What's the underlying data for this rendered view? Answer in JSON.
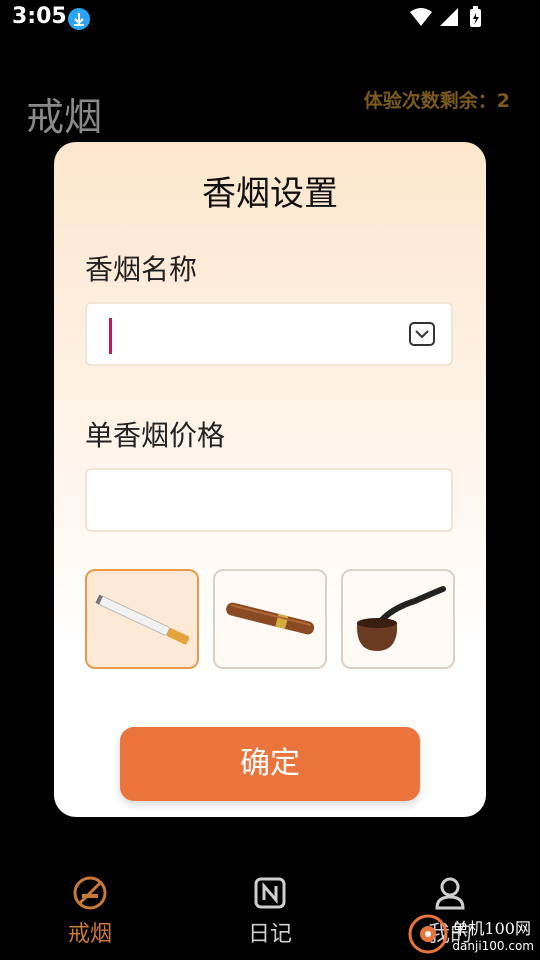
{
  "status_bar": {
    "time": "3:05"
  },
  "header": {
    "title": "戒烟",
    "trial_remaining": "体验次数剩余：2"
  },
  "dialog": {
    "title": "香烟设置",
    "name_label": "香烟名称",
    "name_value": "",
    "price_label": "单香烟价格",
    "price_value": "",
    "types": [
      {
        "icon": "cigarette-icon",
        "selected": true
      },
      {
        "icon": "cigar-icon",
        "selected": false
      },
      {
        "icon": "pipe-icon",
        "selected": false
      }
    ],
    "confirm_label": "确定"
  },
  "bottom_nav": [
    {
      "label": "戒烟",
      "icon": "no-smoking-icon",
      "active": true
    },
    {
      "label": "日记",
      "icon": "diary-icon",
      "active": false
    },
    {
      "label": "我的",
      "icon": "profile-icon",
      "active": false
    }
  ],
  "watermark": {
    "name": "单机100网",
    "url": "danji100.com"
  },
  "colors": {
    "accent": "#ea743b",
    "active_nav": "#c97a3a",
    "trial_text": "#7a5a1e"
  }
}
